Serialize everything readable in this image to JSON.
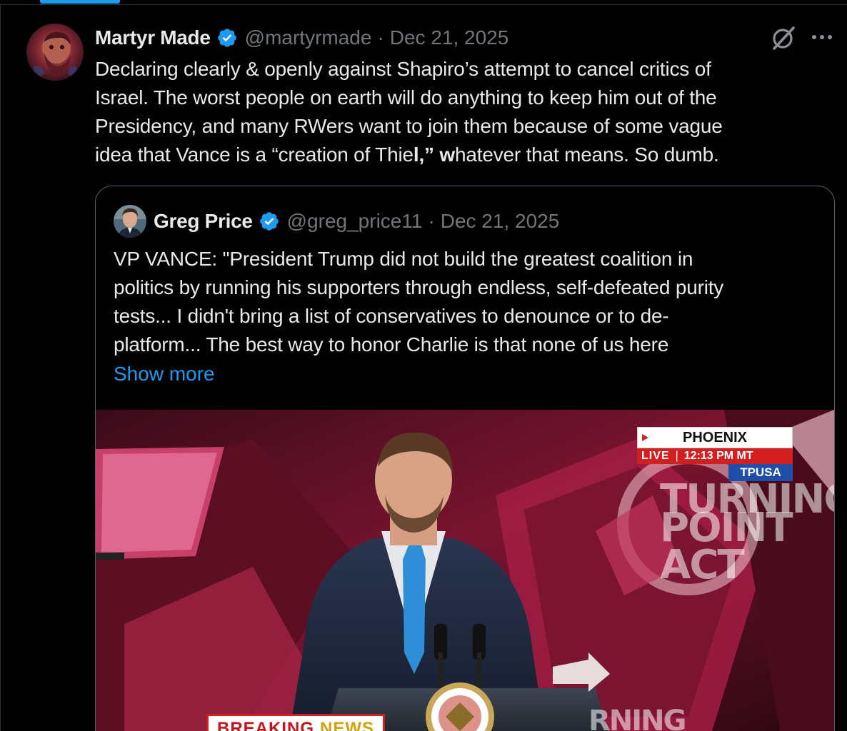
{
  "tweet": {
    "author": {
      "display_name": "Martyr Made",
      "handle": "@martyrmade",
      "verified": true
    },
    "separator": "·",
    "date": "Dec 21, 2025",
    "text_lines": [
      "Declaring clearly & openly against Shapiro’s attempt to cancel critics of",
      "Israel. The worst people on earth will do anything to keep him out of the",
      "Presidency, and many RWers want to join them because of some vague"
    ],
    "text_last_line": {
      "before_bold": "idea that Vance is a “creation of Thie",
      "bold_1": "l,”",
      "middle": " ",
      "bold_2": "w",
      "after": "hatever that means. So dumb."
    },
    "icons": {
      "grok": "grok-icon",
      "more": "more-icon",
      "verified": "verified-badge-icon"
    }
  },
  "quote": {
    "author": {
      "display_name": "Greg Price",
      "handle": "@greg_price11",
      "verified": true
    },
    "separator": "·",
    "date": "Dec 21, 2025",
    "text_lines": [
      "VP VANCE: \"President Trump did not build the greatest coalition in",
      "politics by running his supporters through endless, self-defeated purity",
      "tests... I didn't bring a list of conservatives to denounce or to de-",
      "platform... The best way to honor Charlie is that none of us here"
    ],
    "show_more_label": "Show more",
    "media": {
      "bug_city": "PHOENIX",
      "bug_live": "LIVE",
      "bug_sep": "|",
      "bug_time": "12:13 PM MT",
      "bug_network": "TPUSA",
      "lower_third_1": "BREAKING",
      "lower_third_2": "NEWS",
      "stage_text_top": "TURNING",
      "stage_text_mid": "POINT ACT",
      "stage_text_bottom": "RNING"
    }
  },
  "colors": {
    "background": "#000000",
    "text_primary": "#e7e9ea",
    "text_secondary": "#71767b",
    "accent_blue": "#1d9bf0",
    "border": "#536471"
  }
}
